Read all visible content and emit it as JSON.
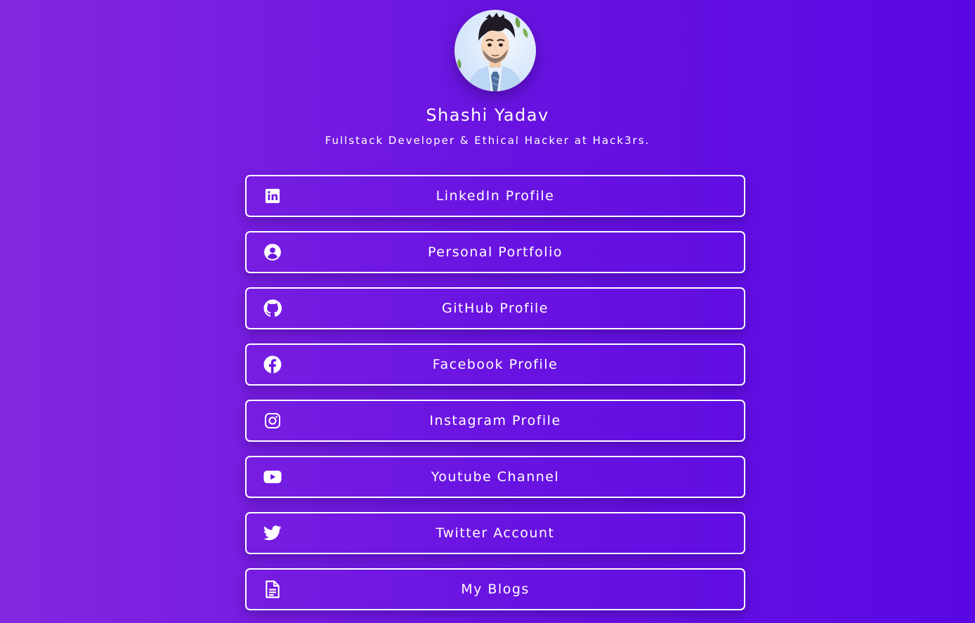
{
  "profile": {
    "name": "Shashi Yadav",
    "tagline": "Fullstack Developer & Ethical Hacker at Hack3rs."
  },
  "links": [
    {
      "label": "LinkedIn Profile",
      "icon": "linkedin-icon"
    },
    {
      "label": "Personal Portfolio",
      "icon": "user-circle-icon"
    },
    {
      "label": "GitHub Profile",
      "icon": "github-icon"
    },
    {
      "label": "Facebook Profile",
      "icon": "facebook-icon"
    },
    {
      "label": "Instagram Profile",
      "icon": "instagram-icon"
    },
    {
      "label": "Youtube Channel",
      "icon": "youtube-icon"
    },
    {
      "label": "Twitter Account",
      "icon": "twitter-icon"
    },
    {
      "label": "My Blogs",
      "icon": "document-icon"
    }
  ],
  "colors": {
    "gradient_start": "#8427e0",
    "gradient_end": "#5908e3",
    "text": "#ffffff"
  }
}
